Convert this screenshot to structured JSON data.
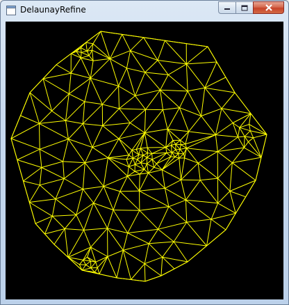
{
  "window": {
    "title": "DelaunayRefine",
    "app_icon": "window-icon",
    "buttons": {
      "minimize_icon": "minimize-icon",
      "maximize_icon": "maximize-icon",
      "close_icon": "close-icon"
    }
  },
  "canvas": {
    "background_color": "#000000",
    "mesh_color": "#ffff00",
    "content": "delaunay-triangulation-mesh"
  }
}
